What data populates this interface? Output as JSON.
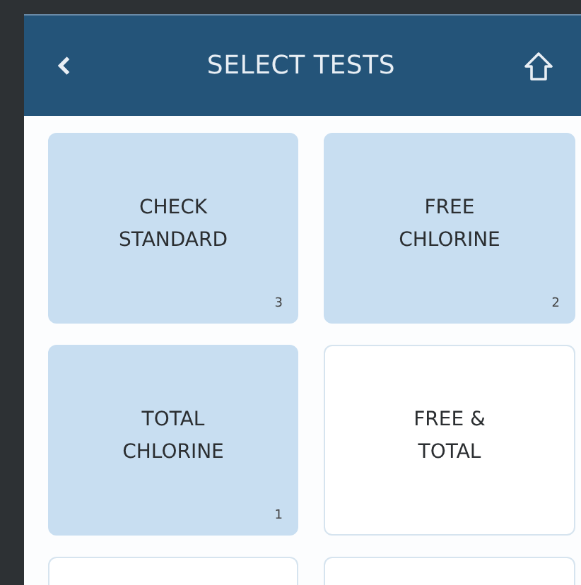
{
  "header": {
    "title": "SELECT TESTS"
  },
  "tests": [
    {
      "label": "CHECK\nSTANDARD",
      "selected": true,
      "order": "3"
    },
    {
      "label": "FREE\nCHLORINE",
      "selected": true,
      "order": "2"
    },
    {
      "label": "TOTAL\nCHLORINE",
      "selected": true,
      "order": "1"
    },
    {
      "label": "FREE &\nTOTAL",
      "selected": false
    },
    {
      "selected": false
    },
    {
      "selected": false
    }
  ]
}
